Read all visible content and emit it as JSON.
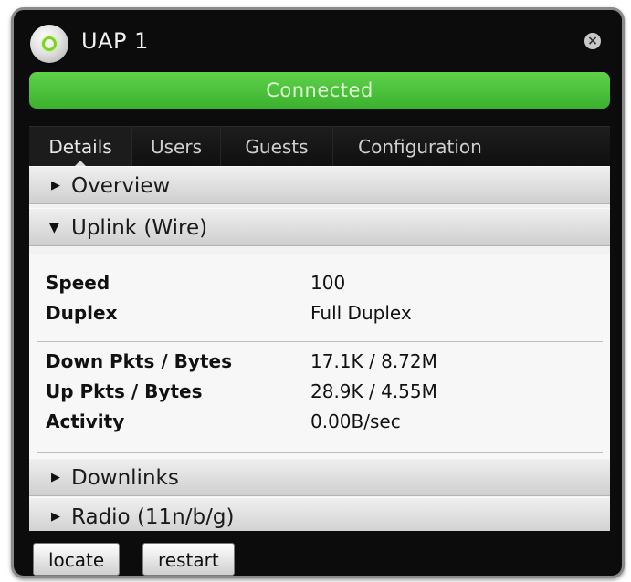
{
  "window": {
    "title": "UAP 1"
  },
  "status": {
    "text": "Connected",
    "color": "#4cc23c"
  },
  "tabs": [
    {
      "label": "Details",
      "active": true
    },
    {
      "label": "Users",
      "active": false
    },
    {
      "label": "Guests",
      "active": false
    },
    {
      "label": "Configuration",
      "active": false
    }
  ],
  "sections": {
    "overview": {
      "label": "Overview",
      "expanded": false
    },
    "uplink": {
      "label": "Uplink (Wire)",
      "expanded": true
    },
    "downlinks": {
      "label": "Downlinks",
      "expanded": false
    },
    "radio": {
      "label": "Radio (11n/b/g)",
      "expanded": false
    }
  },
  "uplink_details": {
    "group1": [
      {
        "key": "Speed",
        "value": "100"
      },
      {
        "key": "Duplex",
        "value": "Full Duplex"
      }
    ],
    "group2": [
      {
        "key": "Down Pkts / Bytes",
        "value": "17.1K / 8.72M"
      },
      {
        "key": "Up Pkts / Bytes",
        "value": "28.9K / 4.55M"
      },
      {
        "key": "Activity",
        "value": "0.00B/sec"
      }
    ]
  },
  "buttons": {
    "locate": "locate",
    "restart": "restart"
  },
  "icons": {
    "device": "access-point-icon",
    "close": "close-icon",
    "collapsed": "triangle-right-icon",
    "expanded": "triangle-down-icon"
  }
}
